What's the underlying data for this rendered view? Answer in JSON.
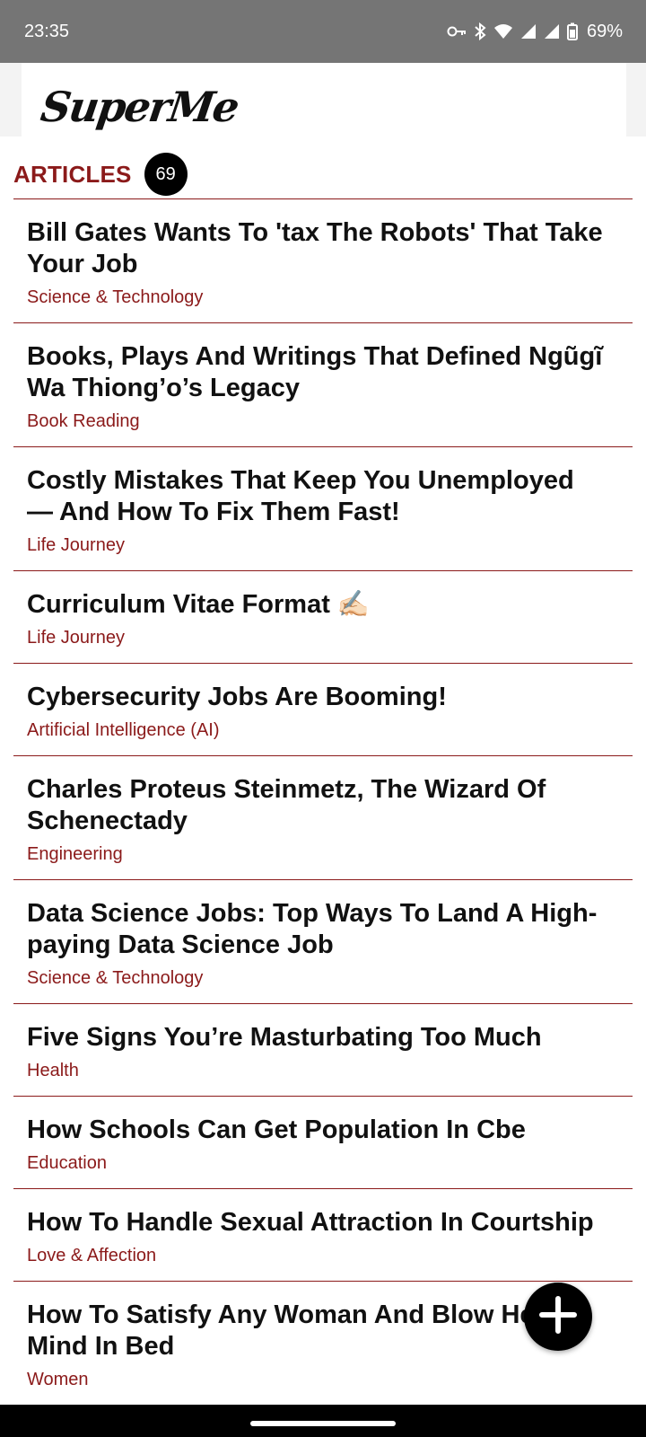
{
  "status_bar": {
    "time": "23:35",
    "battery": "69%",
    "icons": [
      "vpn-key-icon",
      "bluetooth-icon",
      "wifi-icon",
      "signal-icon",
      "signal-icon",
      "battery-icon"
    ]
  },
  "header": {
    "logo_text": "SuperMe"
  },
  "section": {
    "title": "ARTICLES",
    "count": "69"
  },
  "articles": [
    {
      "title": "Bill Gates Wants To 'tax The Robots' That Take Your Job",
      "category": "Science & Technology"
    },
    {
      "title": "Books, Plays And Writings That Defined Ngũgĩ Wa Thiong’o’s Legacy",
      "category": "Book Reading"
    },
    {
      "title": "Costly Mistakes That Keep You Unemployed — And How To Fix Them Fast!",
      "category": "Life Journey"
    },
    {
      "title": "Curriculum Vitae Format ✍🏻",
      "category": "Life Journey"
    },
    {
      "title": "Cybersecurity Jobs Are Booming!",
      "category": "Artificial Intelligence (AI)"
    },
    {
      "title": "Charles Proteus Steinmetz, The Wizard Of Schenectady",
      "category": "Engineering"
    },
    {
      "title": "Data Science Jobs: Top Ways To Land A High-paying Data Science Job",
      "category": "Science & Technology"
    },
    {
      "title": "Five Signs You’re Masturbating Too Much",
      "category": "Health"
    },
    {
      "title": "How Schools Can Get Population In Cbe",
      "category": "Education"
    },
    {
      "title": "How To Handle Sexual Attraction In Courtship",
      "category": "Love & Affection"
    },
    {
      "title": "How To Satisfy Any Woman And Blow Her Mind In Bed",
      "category": "Women"
    }
  ],
  "fab": {
    "icon": "plus-icon"
  },
  "colors": {
    "accent": "#8b1a1a",
    "status_bar": "#757575",
    "badge": "#000000"
  }
}
